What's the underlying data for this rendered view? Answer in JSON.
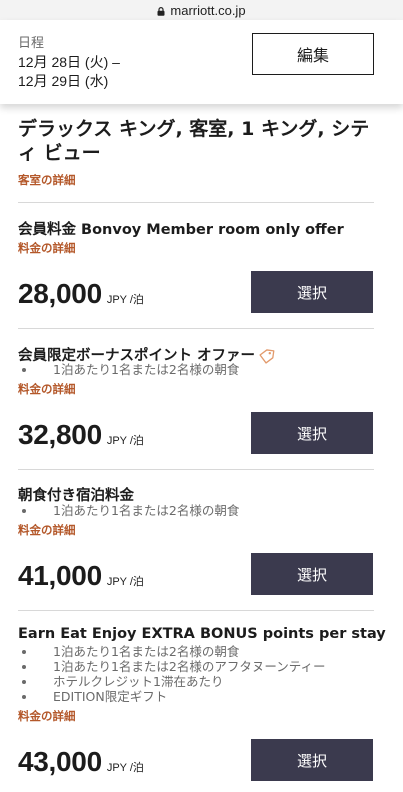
{
  "browser": {
    "url": "marriott.co.jp"
  },
  "dates": {
    "label": "日程",
    "checkin": "12月 28日 (火) –",
    "checkout": "12月 29日 (水)",
    "edit_label": "編集"
  },
  "room": {
    "title": "デラックス キング, 客室, 1 キング, シティ ビュー",
    "details_link": "客室の詳細"
  },
  "rates": [
    {
      "name": "会員料金 Bonvoy Member room only offer",
      "bullets": [],
      "details_link": "料金の詳細",
      "price": "28,000",
      "unit": "JPY /泊",
      "select_label": "選択"
    },
    {
      "name": "会員限定ボーナスポイント オファー",
      "bullets": [
        "1泊あたり1名または2名様の朝食"
      ],
      "details_link": "料金の詳細",
      "price": "32,800",
      "unit": "JPY /泊",
      "select_label": "選択"
    },
    {
      "name": "朝食付き宿泊料金",
      "bullets": [
        "1泊あたり1名または2名様の朝食"
      ],
      "details_link": "料金の詳細",
      "price": "41,000",
      "unit": "JPY /泊",
      "select_label": "選択"
    },
    {
      "name": "Earn Eat Enjoy EXTRA BONUS points per stay",
      "bullets": [
        "1泊あたり1名または2名様の朝食",
        "1泊あたり1名または2名様のアフタヌーンティー",
        "ホテルクレジット1滞在あたり",
        "EDITION限定ギフト"
      ],
      "details_link": "料金の詳細",
      "price": "43,000",
      "unit": "JPY /泊",
      "select_label": "選択"
    }
  ],
  "icons": {
    "url_lock": "lock-icon",
    "offer_tag": "tag-icon"
  },
  "colors": {
    "accent": "#b4582a",
    "button": "#3b3a4e"
  }
}
